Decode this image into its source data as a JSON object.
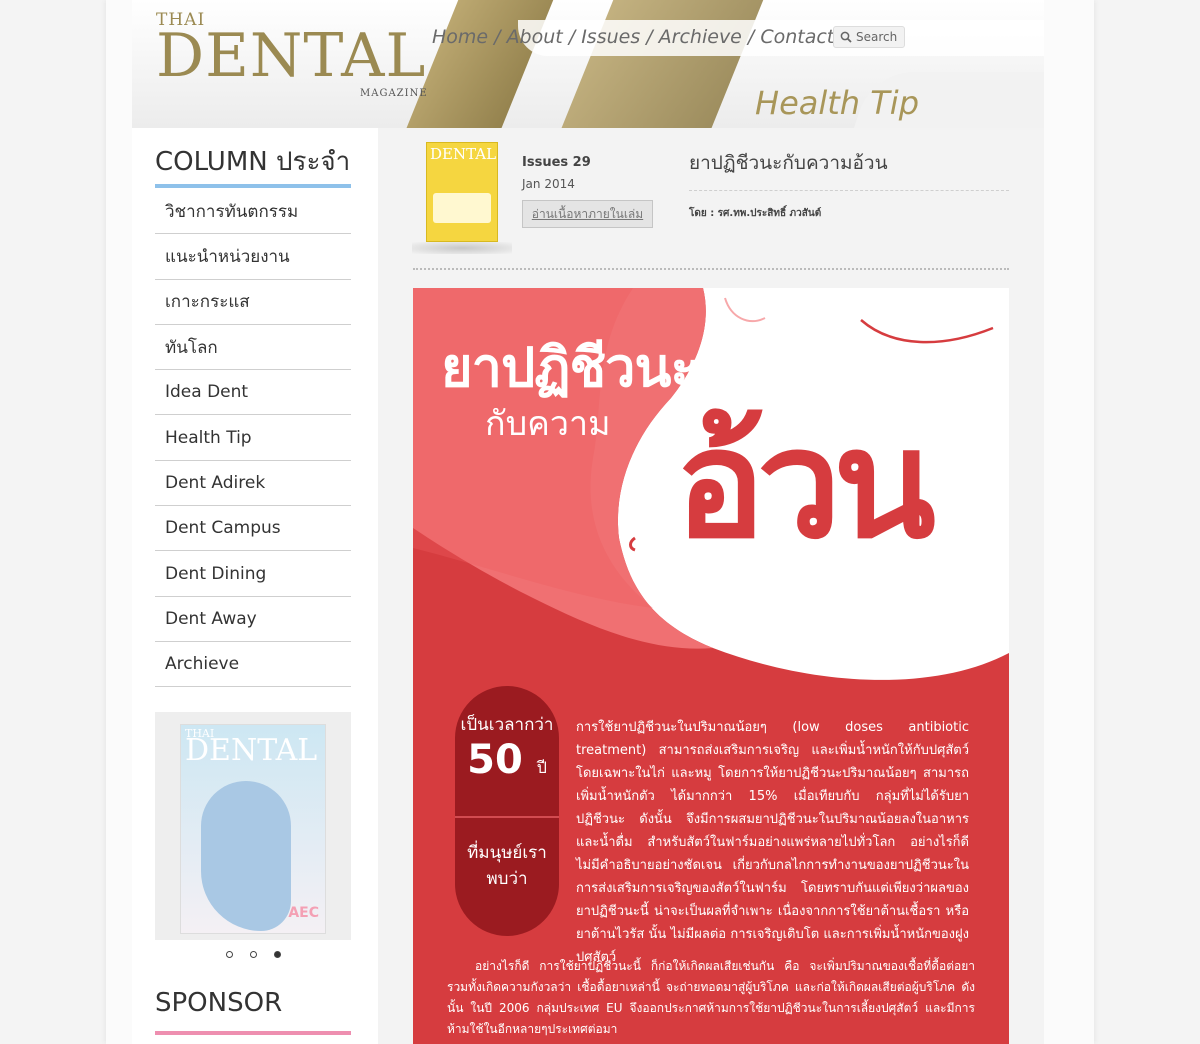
{
  "logo": {
    "thai": "THAI",
    "dental": "DENTAL",
    "magazine": "MAGAZINE"
  },
  "nav": {
    "home": "Home /",
    "about": "About /",
    "issues": "Issues /",
    "archieve": "Archieve",
    "contact": "/ Contact"
  },
  "search": {
    "label": "Search"
  },
  "section_title": "Health Tip",
  "sidebar": {
    "column_title": "COLUMN ประจำ",
    "items": [
      {
        "label": "วิชาการทันตกรรม"
      },
      {
        "label": "แนะนำหน่วยงาน"
      },
      {
        "label": "เกาะกระแส"
      },
      {
        "label": "ทันโลก"
      },
      {
        "label": "Idea Dent"
      },
      {
        "label": "Health Tip"
      },
      {
        "label": "Dent Adirek"
      },
      {
        "label": "Dent Campus"
      },
      {
        "label": "Dent Dining"
      },
      {
        "label": "Dent Away"
      },
      {
        "label": "Archieve"
      }
    ],
    "slider": {
      "cover_thai": "THAI",
      "cover_dental": "DENTAL",
      "cover_series": "AEC",
      "active_dot": 3
    },
    "sponsor_title": "SPONSOR"
  },
  "issue": {
    "cover_title": "DENTAL",
    "number": "Issues 29",
    "date": "Jan 2014",
    "read_button": "อ่านเนื้อหาภายในเล่ม"
  },
  "article": {
    "title": "ยาปฏิชีวนะกับความอ้วน",
    "byline": "โดย : รศ.ทพ.ประสิทธิ์ ภวสันต์"
  },
  "poster": {
    "title_line1": "ยาปฏิชีวนะ",
    "title_line2": "กับความ",
    "big_word": "อ้วน",
    "pill_top_line1": "เป็นเวลากว่า",
    "pill_number": "50",
    "pill_unit": "ปี",
    "pill_bottom": "ที่มนุษย์เรา พบว่า",
    "paragraph1": "การใช้ยาปฏิชีวนะในปริมาณน้อยๆ (low doses antibiotic treatment) สามารถส่งเสริมการเจริญ และเพิ่มน้ำหนักให้กับปศุสัตว์ โดยเฉพาะในไก่ และหมู โดยการให้ยาปฏิชีวนะปริมาณน้อยๆ สามารถเพิ่มน้ำหนักตัว ได้มากกว่า 15% เมื่อเทียบกับ กลุ่มที่ไม่ได้รับยาปฏิชีวนะ ดังนั้น จึงมีการผสมยาปฏิชีวนะในปริมาณน้อยลงในอาหารและน้ำดื่ม สำหรับสัตว์ในฟาร์มอย่างแพร่หลายไปทั่วโลก อย่างไรก็ดี ไม่มีคำอธิบายอย่างชัดเจน เกี่ยวกับกลไกการทำงานของยาปฏิชีวนะในการส่งเสริมการเจริญของสัตว์ในฟาร์ม โดยทราบกันแต่เพียงว่าผลของ ยาปฏิชีวนะนี้ น่าจะเป็นผลที่จำเพาะ เนื่องจากการใช้ยาต้านเชื้อรา หรือ ยาต้านไวรัส นั้น ไม่มีผลต่อ การเจริญเติบโต และการเพิ่มน้ำหนักของฝูงปศุสัตว์",
    "paragraph2": "อย่างไรก็ดี การใช้ยาปฏิชีวนะนี้ ก็ก่อให้เกิดผลเสียเช่นกัน คือ จะเพิ่มปริมาณของเชื้อที่ดื้อต่อยา รวมทั้งเกิดความกังวลว่า เชื้อดื้อยาเหล่านี้ จะถ่ายทอดมาสู่ผู้บริโภค และก่อให้เกิดผลเสียต่อผู้บริโภค ดังนั้น ในปี 2006 กลุ่มประเทศ EU จึงออกประกาศห้ามการใช้ยาปฏิชีวนะในการเลี้ยงปศุสัตว์ และมีการห้ามใช้ในอีกหลายๆประเทศต่อมา"
  },
  "colors": {
    "gold": "#9b8a52",
    "poster_red": "#d63c3f",
    "pill_dark": "#9b1b20",
    "menu_bar": "#8ec1ea",
    "sponsor_bar": "#ee8fb0"
  }
}
